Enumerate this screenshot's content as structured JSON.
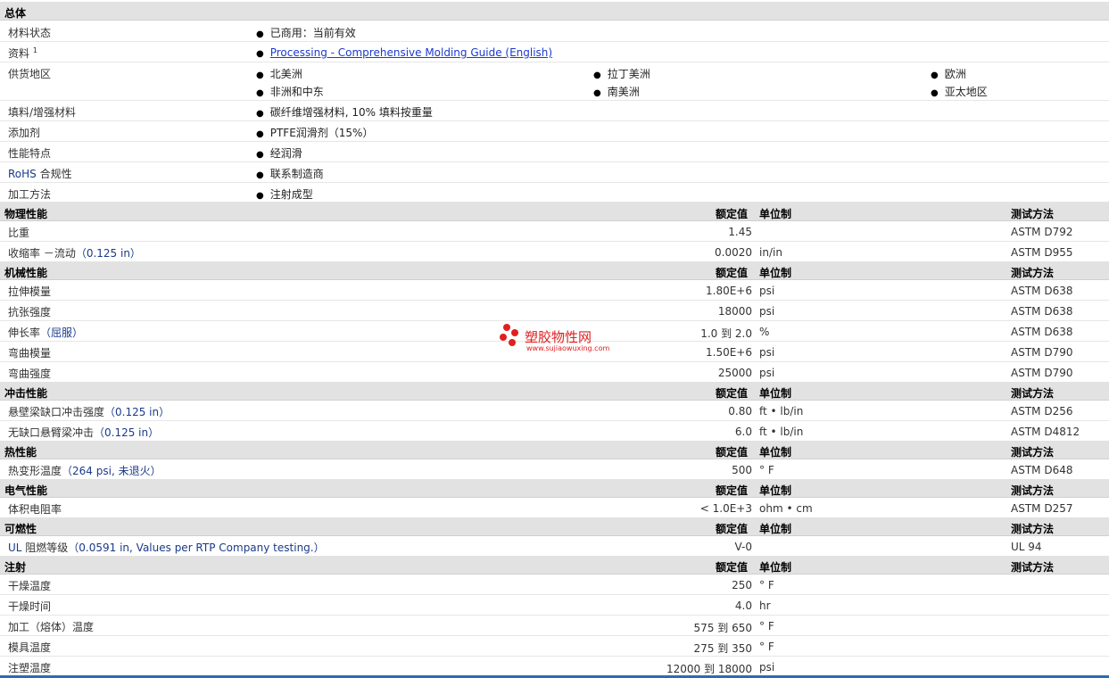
{
  "general": {
    "title": "总体",
    "material_status": {
      "label": "材料状态",
      "value": "已商用：当前有效"
    },
    "documents": {
      "label": "资料",
      "sup": "1",
      "link": "Processing - Comprehensive Molding Guide (English)"
    },
    "regions": {
      "label": "供货地区",
      "items": [
        "北美洲",
        "拉丁美洲",
        "欧洲",
        "非洲和中东",
        "南美洲",
        "亚太地区"
      ]
    },
    "filler": {
      "label": "填料/增强材料",
      "value": "碳纤维增强材料, 10% 填料按重量"
    },
    "additive": {
      "label": "添加剂",
      "value": "PTFE润滑剂（15%）"
    },
    "features": {
      "label": "性能特点",
      "value": "经润滑"
    },
    "rohs": {
      "label_prefix": "RoHS",
      "label_suffix": " 合规性",
      "value": "联系制造商"
    },
    "processing": {
      "label": "加工方法",
      "value": "注射成型"
    }
  },
  "headers": {
    "value": "额定值",
    "unit": "单位制",
    "method": "测试方法"
  },
  "sections": {
    "physical": {
      "title": "物理性能",
      "rows": [
        {
          "label": "比重",
          "cond": "",
          "value": "1.45",
          "unit": "",
          "method": "ASTM D792"
        },
        {
          "label": "收缩率 －流动",
          "cond": "（0.125 in）",
          "value": "0.0020",
          "unit": "in/in",
          "method": "ASTM D955"
        }
      ]
    },
    "mechanical": {
      "title": "机械性能",
      "rows": [
        {
          "label": "拉伸模量",
          "cond": "",
          "value": "1.80E+6",
          "unit": "psi",
          "method": "ASTM D638"
        },
        {
          "label": "抗张强度",
          "cond": "",
          "value": "18000",
          "unit": "psi",
          "method": "ASTM D638"
        },
        {
          "label": "伸长率",
          "cond": "（屈服）",
          "value": "1.0 到  2.0",
          "unit": "%",
          "method": "ASTM D638"
        },
        {
          "label": "弯曲模量",
          "cond": "",
          "value": "1.50E+6",
          "unit": "psi",
          "method": "ASTM D790"
        },
        {
          "label": "弯曲强度",
          "cond": "",
          "value": "25000",
          "unit": "psi",
          "method": "ASTM D790"
        }
      ]
    },
    "impact": {
      "title": "冲击性能",
      "rows": [
        {
          "label": "悬壁梁缺口冲击强度",
          "cond": "（0.125 in）",
          "value": "0.80",
          "unit": "ft • lb/in",
          "method": "ASTM D256"
        },
        {
          "label": "无缺口悬臂梁冲击",
          "cond": "（0.125 in）",
          "value": "6.0",
          "unit": "ft • lb/in",
          "method": "ASTM D4812"
        }
      ]
    },
    "thermal": {
      "title": "热性能",
      "rows": [
        {
          "label": "热变形温度",
          "cond": "（264 psi, 未退火）",
          "value": "500",
          "unit": "° F",
          "method": "ASTM D648"
        }
      ]
    },
    "electrical": {
      "title": "电气性能",
      "rows": [
        {
          "label": "体积电阻率",
          "cond": "",
          "value": "< 1.0E+3",
          "unit": "ohm • cm",
          "method": "ASTM D257"
        }
      ]
    },
    "flammability": {
      "title": "可燃性",
      "rows": [
        {
          "label_prefix": "UL",
          "label": " 阻燃等级",
          "cond": "（0.0591 in, Values per RTP Company testing.）",
          "value": "V-0",
          "unit": "",
          "method": "UL 94"
        }
      ]
    },
    "injection": {
      "title": "注射",
      "rows": [
        {
          "label": "干燥温度",
          "cond": "",
          "value": "250",
          "unit": "° F",
          "method": ""
        },
        {
          "label": "干燥时间",
          "cond": "",
          "value": "4.0",
          "unit": "hr",
          "method": ""
        },
        {
          "label": "加工（熔体）温度",
          "cond": "",
          "value": "575 到  650",
          "unit": "° F",
          "method": ""
        },
        {
          "label": "模具温度",
          "cond": "",
          "value": "275 到  350",
          "unit": "° F",
          "method": ""
        },
        {
          "label": "注塑温度",
          "cond": "",
          "value": "12000 到  18000",
          "unit": "psi",
          "method": ""
        }
      ]
    }
  },
  "watermark": {
    "text": "塑胶物性网",
    "sub": "www.sujiaowuxing.com"
  }
}
